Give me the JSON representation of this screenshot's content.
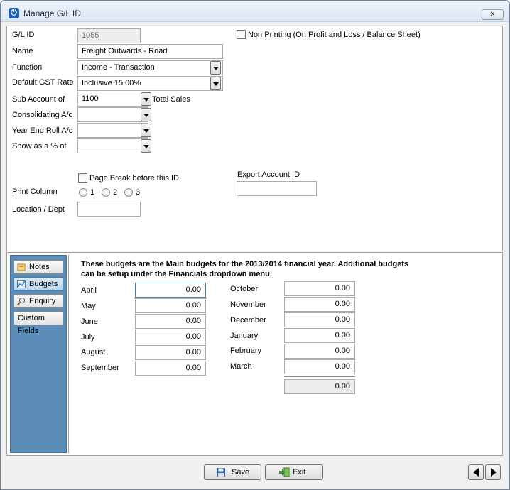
{
  "window": {
    "title": "Manage G/L ID"
  },
  "form": {
    "gl_id_label": "G/L ID",
    "gl_id_value": "1055",
    "non_printing_label": "Non Printing (On Profit and Loss / Balance Sheet)",
    "name_label": "Name",
    "name_value": "Freight Outwards - Road",
    "function_label": "Function",
    "function_value": "Income - Transaction",
    "gst_label": "Default GST Rate",
    "gst_value": "Inclusive 15.00%",
    "sub_account_label": "Sub Account of",
    "sub_account_value": "1100",
    "sub_account_desc": "Total Sales",
    "consolidating_label": "Consolidating A/c",
    "consolidating_value": "",
    "year_end_label": "Year End Roll A/c",
    "year_end_value": "",
    "show_as_label": "Show as a % of",
    "show_as_value": "",
    "page_break_label": "Page Break before this ID",
    "export_label": "Export Account ID",
    "export_value": "",
    "print_column_label": "Print Column",
    "print_options": [
      "1",
      "2",
      "3"
    ],
    "location_label": "Location / Dept",
    "location_value": ""
  },
  "sidebar": {
    "items": [
      {
        "label": "Notes",
        "icon": "notes-icon"
      },
      {
        "label": "Budgets",
        "icon": "budgets-icon"
      },
      {
        "label": "Enquiry",
        "icon": "magnifier-icon"
      },
      {
        "label": "Custom Fields"
      }
    ]
  },
  "budgets": {
    "note_line1": "These budgets are the Main budgets for the 2013/2014 financial year.  Additional budgets",
    "note_line2": "can be setup under the Financials dropdown menu.",
    "left": [
      {
        "month": "April",
        "value": "0.00"
      },
      {
        "month": "May",
        "value": "0.00"
      },
      {
        "month": "June",
        "value": "0.00"
      },
      {
        "month": "July",
        "value": "0.00"
      },
      {
        "month": "August",
        "value": "0.00"
      },
      {
        "month": "September",
        "value": "0.00"
      }
    ],
    "right": [
      {
        "month": "October",
        "value": "0.00"
      },
      {
        "month": "November",
        "value": "0.00"
      },
      {
        "month": "December",
        "value": "0.00"
      },
      {
        "month": "January",
        "value": "0.00"
      },
      {
        "month": "February",
        "value": "0.00"
      },
      {
        "month": "March",
        "value": "0.00"
      }
    ],
    "total": "0.00"
  },
  "footer": {
    "save_label": "Save",
    "exit_label": "Exit"
  }
}
